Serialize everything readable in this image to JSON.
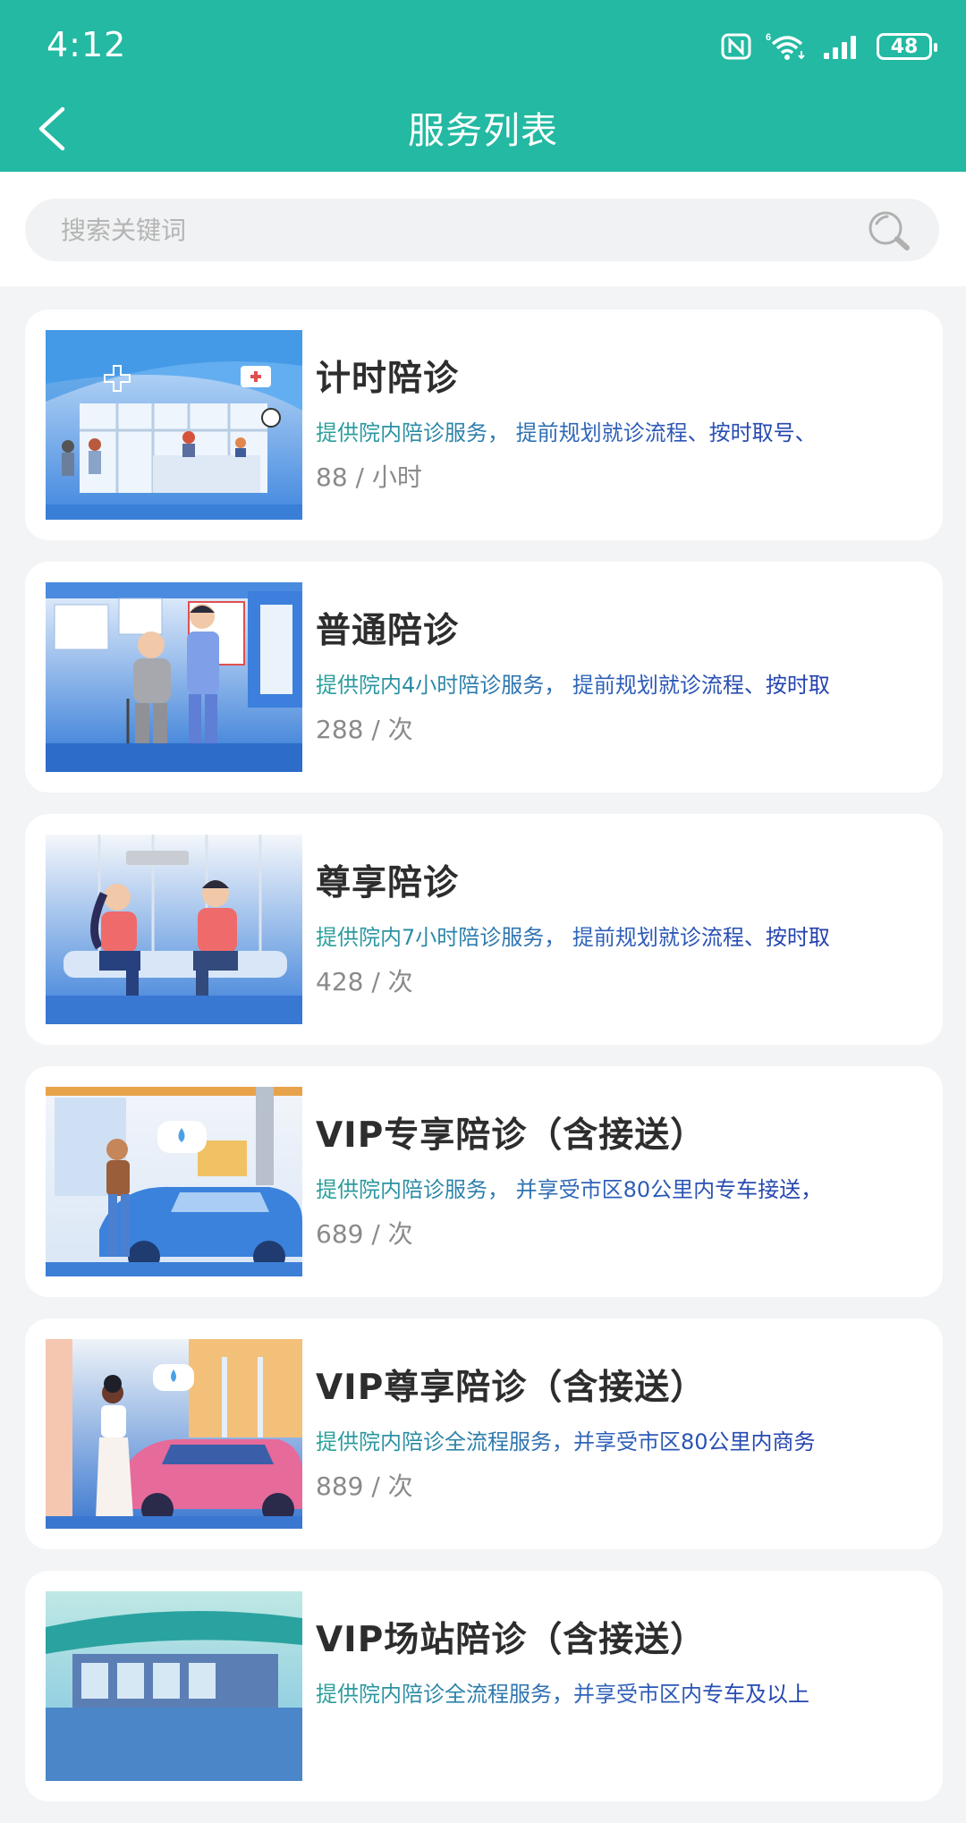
{
  "status_bar": {
    "time": "4:12",
    "battery": "48"
  },
  "header": {
    "title": "服务列表"
  },
  "search": {
    "placeholder": "搜索关键词"
  },
  "services": [
    {
      "title": "计时陪诊",
      "desc": "提供院内陪诊服务， 提前规划就诊流程、按时取号、",
      "price": "88 / 小时"
    },
    {
      "title": "普通陪诊",
      "desc": "提供院内4小时陪诊服务， 提前规划就诊流程、按时取",
      "price": "288 / 次"
    },
    {
      "title": "尊享陪诊",
      "desc": "提供院内7小时陪诊服务， 提前规划就诊流程、按时取",
      "price": "428 / 次"
    },
    {
      "title": "VIP专享陪诊（含接送）",
      "desc": "提供院内陪诊服务， 并享受市区80公里内专车接送，",
      "price": "689 / 次"
    },
    {
      "title": "VIP尊享陪诊（含接送）",
      "desc": "提供院内陪诊全流程服务，并享受市区80公里内商务",
      "price": "889 / 次"
    },
    {
      "title": "VIP场站陪诊（含接送）",
      "desc": "提供院内陪诊全流程服务，并享受市区内专车及以上",
      "price": ""
    }
  ]
}
